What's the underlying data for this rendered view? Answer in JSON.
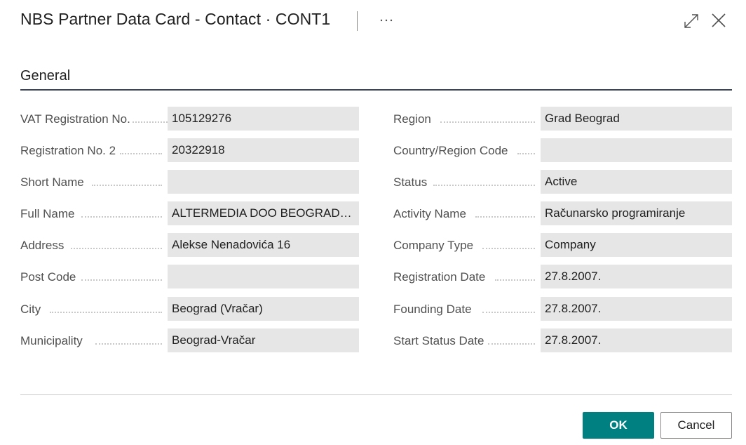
{
  "header": {
    "title": "NBS Partner Data Card - Contact · CONT1",
    "more_icon": "ellipsis-icon",
    "expand_icon": "expand-icon",
    "close_icon": "close-icon"
  },
  "section": {
    "title": "General"
  },
  "left_fields": [
    {
      "label": "VAT Registration No.",
      "value": "105129276"
    },
    {
      "label": "Registration No. 2",
      "value": "20322918"
    },
    {
      "label": "Short Name",
      "value": ""
    },
    {
      "label": "Full Name",
      "value": "ALTERMEDIA DOO  BEOGRAD (V..."
    },
    {
      "label": "Address",
      "value": "Alekse Nenadovića 16"
    },
    {
      "label": "Post Code",
      "value": ""
    },
    {
      "label": "City",
      "value": "Beograd (Vračar)"
    },
    {
      "label": "Municipality",
      "value": "Beograd-Vračar"
    }
  ],
  "right_fields": [
    {
      "label": "Region",
      "value": "Grad Beograd"
    },
    {
      "label": "Country/Region Code",
      "value": ""
    },
    {
      "label": "Status",
      "value": "Active"
    },
    {
      "label": "Activity Name",
      "value": "Računarsko programiranje"
    },
    {
      "label": "Company Type",
      "value": "Company"
    },
    {
      "label": "Registration Date",
      "value": "27.8.2007."
    },
    {
      "label": "Founding Date",
      "value": "27.8.2007."
    },
    {
      "label": "Start Status Date",
      "value": "27.8.2007."
    }
  ],
  "footer": {
    "ok_label": "OK",
    "cancel_label": "Cancel"
  },
  "colors": {
    "accent": "#008080",
    "field_bg": "#e6e6e6",
    "section_rule": "#3b4557"
  }
}
